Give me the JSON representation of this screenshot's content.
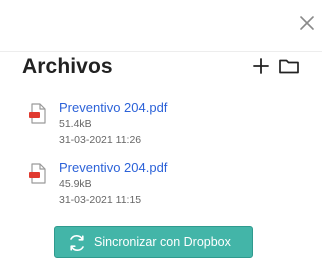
{
  "panel": {
    "title": "Archivos",
    "icons": {
      "close": "close-icon",
      "add": "plus-icon",
      "folder": "folder-icon"
    }
  },
  "files": [
    {
      "name": "Preventivo 204.pdf",
      "size": "51.4kB",
      "date": "31-03-2021 11:26",
      "icon": "pdf-file-icon"
    },
    {
      "name": "Preventivo 204.pdf",
      "size": "45.9kB",
      "date": "31-03-2021 11:15",
      "icon": "pdf-file-icon"
    }
  ],
  "sync_button": {
    "label": "Sincronizar con Dropbox",
    "icon": "sync-icon",
    "color": "#43b5a8"
  },
  "colors": {
    "link": "#2c62d8",
    "pdf_red": "#e03a2f",
    "meta_text": "#666666"
  }
}
